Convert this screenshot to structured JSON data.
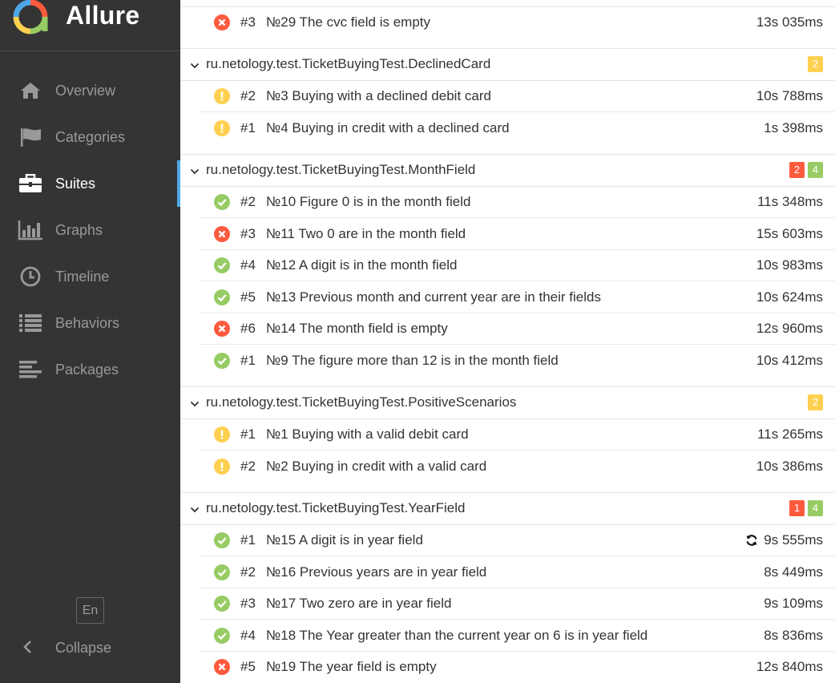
{
  "app": {
    "name": "Allure"
  },
  "nav": {
    "overview": "Overview",
    "categories": "Categories",
    "suites": "Suites",
    "graphs": "Graphs",
    "timeline": "Timeline",
    "behaviors": "Behaviors",
    "packages": "Packages",
    "lang": "En",
    "collapse": "Collapse"
  },
  "colors": {
    "failed": "#fd5a3e",
    "passed": "#97cc64",
    "broken": "#ffd050",
    "accent": "#4ea7e8"
  },
  "tree": {
    "g0": {
      "rows": [
        {
          "status": "failed",
          "order": "#3",
          "name": "№29 The cvc field is empty",
          "duration": "13s 035ms"
        }
      ]
    },
    "g1": {
      "name": "ru.netology.test.TicketBuyingTest.DeclinedCard",
      "badges": [
        {
          "type": "broken",
          "count": "2"
        }
      ],
      "rows": [
        {
          "status": "broken",
          "order": "#2",
          "name": "№3 Buying with a declined debit card",
          "duration": "10s 788ms"
        },
        {
          "status": "broken",
          "order": "#1",
          "name": "№4 Buying in credit with a declined card",
          "duration": "1s 398ms"
        }
      ]
    },
    "g2": {
      "name": "ru.netology.test.TicketBuyingTest.MonthField",
      "badges": [
        {
          "type": "failed",
          "count": "2"
        },
        {
          "type": "passed",
          "count": "4"
        }
      ],
      "rows": [
        {
          "status": "passed",
          "order": "#2",
          "name": "№10 Figure 0 is in the month field",
          "duration": "11s 348ms"
        },
        {
          "status": "failed",
          "order": "#3",
          "name": "№11 Two 0 are in the month field",
          "duration": "15s 603ms"
        },
        {
          "status": "passed",
          "order": "#4",
          "name": "№12 A digit is in the month field",
          "duration": "10s 983ms"
        },
        {
          "status": "passed",
          "order": "#5",
          "name": "№13 Previous month and current year are in their fields",
          "duration": "10s 624ms"
        },
        {
          "status": "failed",
          "order": "#6",
          "name": "№14 The month field is empty",
          "duration": "12s 960ms"
        },
        {
          "status": "passed",
          "order": "#1",
          "name": "№9 The figure more than 12 is in the month field",
          "duration": "10s 412ms"
        }
      ]
    },
    "g3": {
      "name": "ru.netology.test.TicketBuyingTest.PositiveScenarios",
      "badges": [
        {
          "type": "broken",
          "count": "2"
        }
      ],
      "rows": [
        {
          "status": "broken",
          "order": "#1",
          "name": "№1 Buying with a valid debit card",
          "duration": "11s 265ms"
        },
        {
          "status": "broken",
          "order": "#2",
          "name": "№2 Buying in credit with a valid card",
          "duration": "10s 386ms"
        }
      ]
    },
    "g4": {
      "name": "ru.netology.test.TicketBuyingTest.YearField",
      "badges": [
        {
          "type": "failed",
          "count": "1"
        },
        {
          "type": "passed",
          "count": "4"
        }
      ],
      "rows": [
        {
          "status": "passed",
          "order": "#1",
          "name": "№15 A digit is in year field",
          "duration": "9s 555ms",
          "retry": true
        },
        {
          "status": "passed",
          "order": "#2",
          "name": "№16 Previous years are in year field",
          "duration": "8s 449ms"
        },
        {
          "status": "passed",
          "order": "#3",
          "name": "№17 Two zero are in year field",
          "duration": "9s 109ms"
        },
        {
          "status": "passed",
          "order": "#4",
          "name": "№18 The Year greater than the current year on 6 is in year field",
          "duration": "8s 836ms"
        },
        {
          "status": "failed",
          "order": "#5",
          "name": "№19 The year field is empty",
          "duration": "12s 840ms"
        }
      ]
    }
  }
}
